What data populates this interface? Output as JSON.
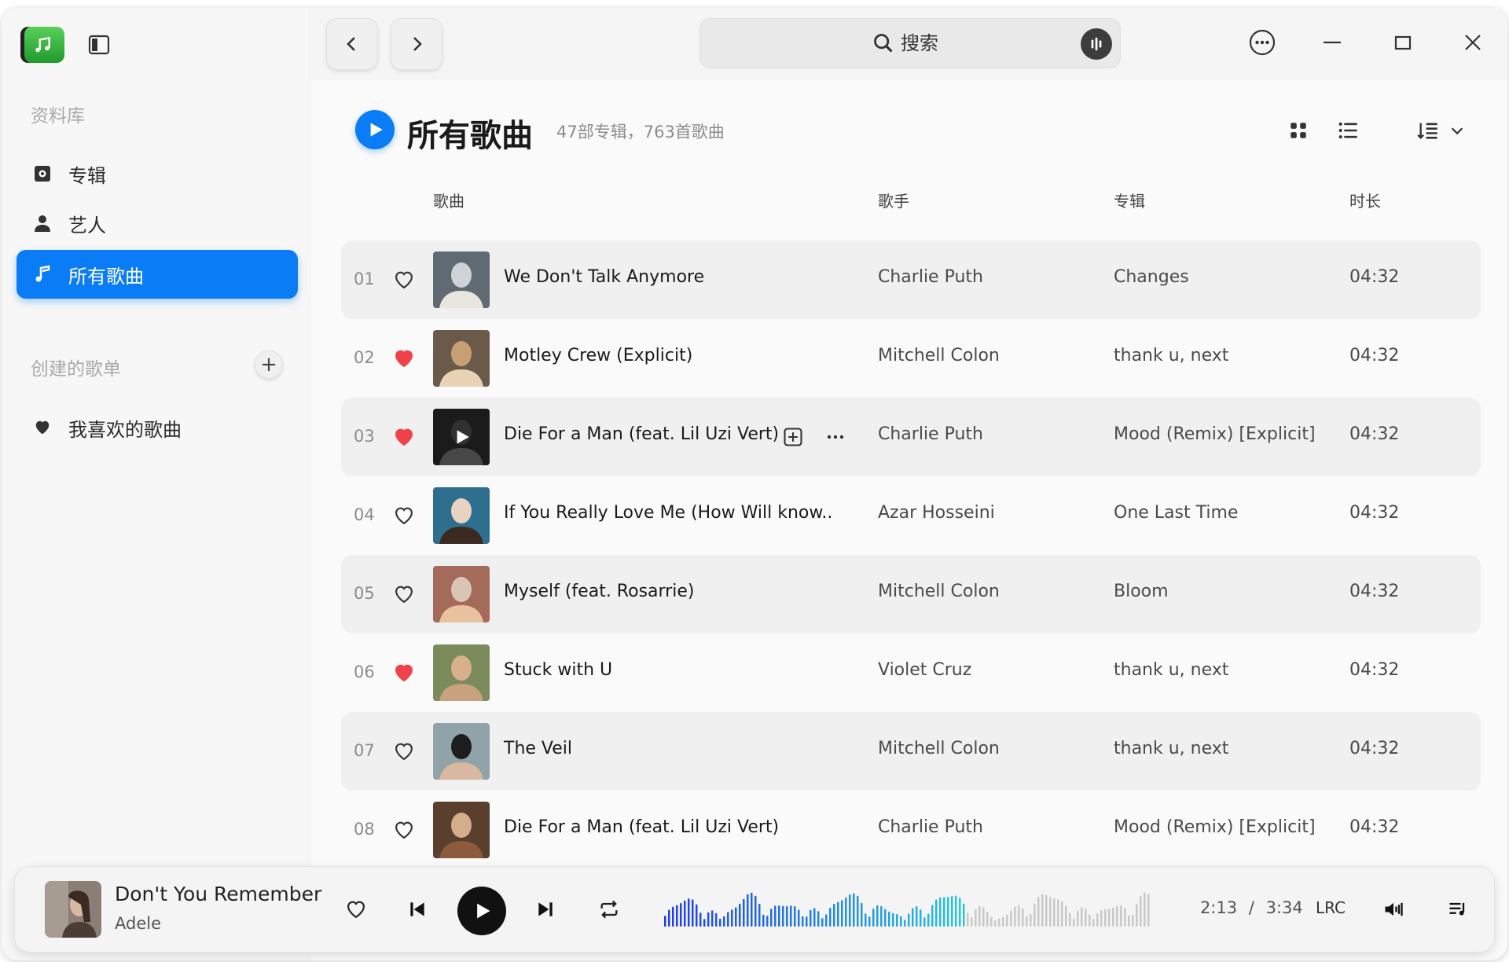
{
  "sidebar": {
    "library_title": "资料库",
    "items": [
      {
        "label": "专辑"
      },
      {
        "label": "艺人"
      },
      {
        "label": "所有歌曲"
      }
    ],
    "playlists_title": "创建的歌单",
    "playlists": [
      {
        "label": "我喜欢的歌曲"
      }
    ]
  },
  "search": {
    "placeholder": "搜索"
  },
  "header": {
    "title": "所有歌曲",
    "subtitle": "47部专辑，763首歌曲"
  },
  "columns": {
    "song": "歌曲",
    "artist": "歌手",
    "album": "专辑",
    "duration": "时长"
  },
  "songs": [
    {
      "num": "01",
      "liked": false,
      "title": "We Don't Talk Anymore",
      "artist": "Charlie Puth",
      "album": "Changes",
      "duration": "04:32"
    },
    {
      "num": "02",
      "liked": true,
      "title": "Motley Crew (Explicit)",
      "artist": "Mitchell Colon",
      "album": "thank u, next",
      "duration": "04:32"
    },
    {
      "num": "03",
      "liked": true,
      "title": "Die For a Man (feat. Lil Uzi Vert)",
      "artist": "Charlie Puth",
      "album": "Mood (Remix) [Explicit]",
      "duration": "04:32"
    },
    {
      "num": "04",
      "liked": false,
      "title": "If You Really Love Me (How Will know..",
      "artist": "Azar Hosseini",
      "album": "One Last Time",
      "duration": "04:32"
    },
    {
      "num": "05",
      "liked": false,
      "title": "Myself (feat. Rosarrie)",
      "artist": "Mitchell Colon",
      "album": "Bloom",
      "duration": "04:32"
    },
    {
      "num": "06",
      "liked": true,
      "title": "Stuck with U",
      "artist": "Violet Cruz",
      "album": "thank u, next",
      "duration": "04:32"
    },
    {
      "num": "07",
      "liked": false,
      "title": "The Veil",
      "artist": "Mitchell Colon",
      "album": "thank u, next",
      "duration": "04:32"
    },
    {
      "num": "08",
      "liked": false,
      "title": "Die For a Man (feat. Lil Uzi Vert)",
      "artist": "Charlie Puth",
      "album": "Mood (Remix) [Explicit]",
      "duration": "04:32"
    }
  ],
  "player": {
    "title": "Don't You Remember",
    "artist": "Adele",
    "elapsed": "2:13",
    "separator": "/",
    "total": "3:34",
    "lrc": "LRC",
    "progress": 0.62
  },
  "colors": {
    "accent": "#0a7cf5",
    "liked": "#f0424b"
  }
}
